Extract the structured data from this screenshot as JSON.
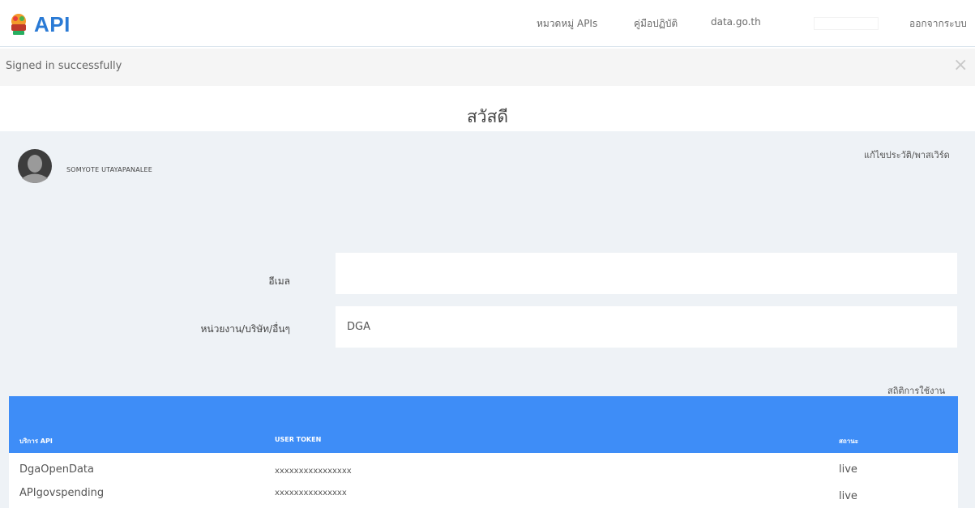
{
  "header": {
    "logo_text": "API",
    "nav": {
      "categories": "หมวดหมู่ APIs",
      "manual": "คู่มือปฏิบัติ",
      "portal": "data.go.th",
      "logout": "ออกจากระบบ"
    }
  },
  "flash": {
    "message": "Signed in successfully",
    "close": "×"
  },
  "greeting": "สวัสดี",
  "profile": {
    "name": "SOMYOTE UTAYAPANALEE",
    "edit_link": "แก้ไขประวัติ/พาสเวิร์ด",
    "email_label": "อีเมล",
    "email_value": "",
    "org_label": "หน่วยงาน/บริษัท/อื่นๆ",
    "org_value": "DGA",
    "stats_link": "สถิติการใช้งาน"
  },
  "table": {
    "headers": {
      "service": "บริการ API",
      "token": "USER TOKEN",
      "status": "สถานะ"
    },
    "rows": [
      {
        "service": "DgaOpenData",
        "token": "xxxxxxxxxxxxxxxx",
        "status": "live"
      },
      {
        "service": "APIgovspending",
        "token": "xxxxxxxxxxxxxxx",
        "status": "live"
      }
    ]
  },
  "colors": {
    "brand": "#2a7ad5",
    "table_header": "#3e8df7",
    "panel_bg": "#eef2f6"
  }
}
